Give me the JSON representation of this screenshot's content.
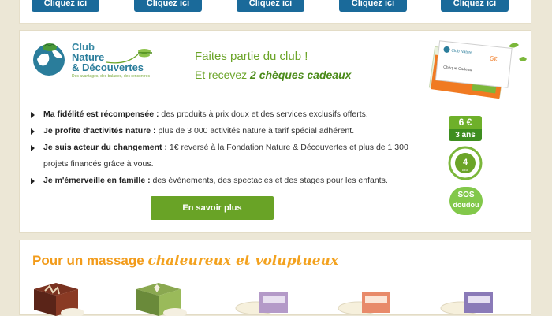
{
  "top_buttons": [
    "Cliquez ici",
    "Cliquez ici",
    "Cliquez ici",
    "Cliquez ici",
    "Cliquez ici"
  ],
  "club": {
    "logo_line1": "Club",
    "logo_line2": "Nature",
    "logo_line3": "& Découvertes",
    "logo_tagline": "Des avantages, des balades, des rencontres",
    "join_title": "Faites partie du club !",
    "join_sub_prefix": "Et recevez ",
    "join_sub_bold": "2 chèques cadeaux",
    "cheque_amount": "5€",
    "cheque_label": "Chèque Cadeau",
    "benefits": [
      {
        "bold": "Ma fidélité est récompensée :",
        "text": " des produits à prix doux et des services exclusifs offerts."
      },
      {
        "bold": "Je profite d'activités nature :",
        "text": " plus de 3 000 activités nature à tarif spécial adhérent."
      },
      {
        "bold": "Je suis acteur du changement :",
        "text": " 1€ reversé à la Fondation Nature & Découvertes et plus de 1 300 projets financés grâce à vous."
      },
      {
        "bold": "Je m'émerveille en famille :",
        "text": " des événements, des spectacles et des stages pour les enfants."
      }
    ],
    "cta_label": "En savoir plus",
    "badge_price": "6 €",
    "badge_years": "3 ans",
    "badge_4": "4",
    "badge_4_unit": "ans",
    "badge_sos": "SOS",
    "badge_doudou": "doudou"
  },
  "massage": {
    "title_prefix": "Pour un massage ",
    "title_highlight": "chaleureux et voluptueux"
  },
  "colors": {
    "accent_green": "#69a326",
    "blue_button": "#1a6a9a",
    "orange_title": "#f29b1a"
  }
}
